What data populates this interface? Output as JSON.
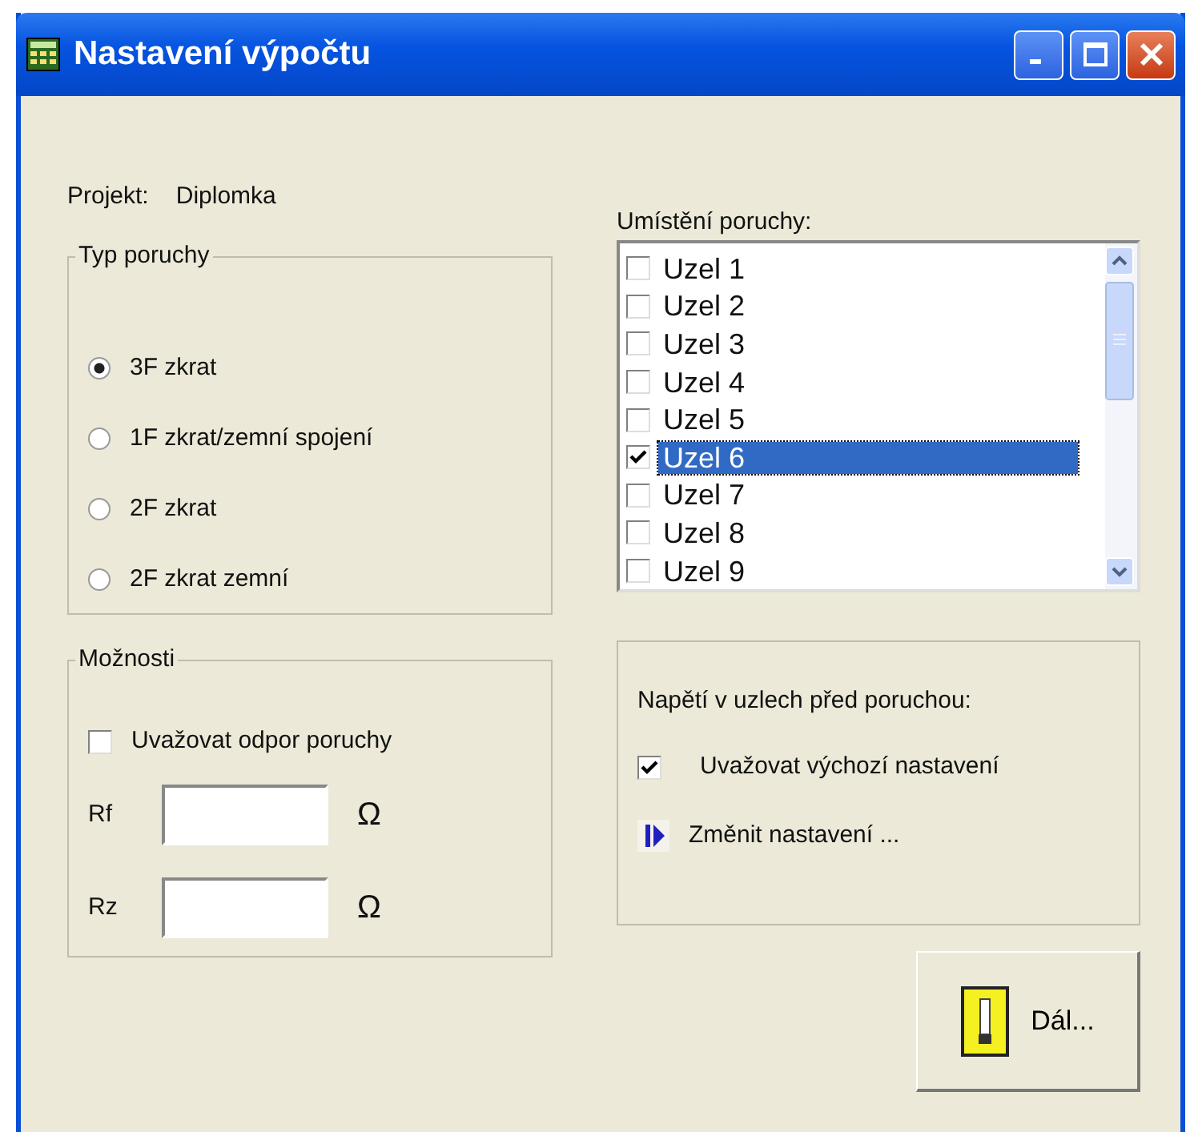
{
  "window": {
    "title": "Nastavení výpočtu"
  },
  "project": {
    "label": "Projekt:",
    "value": "Diplomka"
  },
  "fault_type": {
    "title": "Typ poruchy",
    "options": [
      {
        "label": "3F zkrat",
        "selected": true
      },
      {
        "label": "1F zkrat/zemní spojení",
        "selected": false
      },
      {
        "label": "2F zkrat",
        "selected": false
      },
      {
        "label": "2F zkrat zemní",
        "selected": false
      }
    ]
  },
  "options": {
    "title": "Možnosti",
    "checkbox": {
      "label": "Uvažovat odpor poruchy",
      "checked": false
    },
    "fields": [
      {
        "label": "Rf",
        "unit": "Ω"
      },
      {
        "label": "Rz",
        "unit": "Ω"
      }
    ]
  },
  "fault_location": {
    "label": "Umístění poruchy:",
    "items": [
      {
        "label": "Uzel 1",
        "checked": false,
        "selected": false
      },
      {
        "label": "Uzel 2",
        "checked": false,
        "selected": false
      },
      {
        "label": "Uzel 3",
        "checked": false,
        "selected": false
      },
      {
        "label": "Uzel 4",
        "checked": false,
        "selected": false
      },
      {
        "label": "Uzel 5",
        "checked": false,
        "selected": false
      },
      {
        "label": "Uzel 6",
        "checked": true,
        "selected": true
      },
      {
        "label": "Uzel 7",
        "checked": false,
        "selected": false
      },
      {
        "label": "Uzel 8",
        "checked": false,
        "selected": false
      },
      {
        "label": "Uzel 9",
        "checked": false,
        "selected": false
      }
    ]
  },
  "voltage": {
    "label": "Napětí v uzlech před poruchou:",
    "checkbox": {
      "label": "Uvažovat výchozí nastavení",
      "checked": true
    },
    "link": "Změnit nastavení ..."
  },
  "next_button": "Dál..."
}
